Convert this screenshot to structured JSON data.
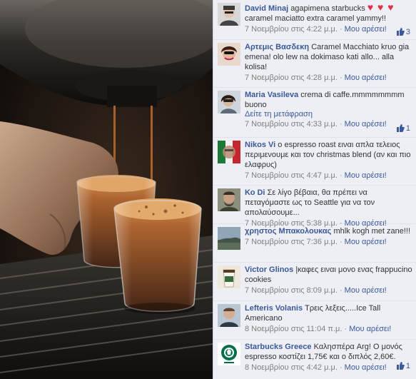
{
  "comments": [
    {
      "author": "David Minaj",
      "text": "agapimena starbucks",
      "hearts": "♥ ♥ ♥",
      "text2": "caramel maciatto extra caramel yammy!!",
      "time": "7 Νοεμβρίου στις 4:22 μ.μ.",
      "like_label": "Μου αρέσει!",
      "likes": "3",
      "sep": " · "
    },
    {
      "author": "Αρτεμις Βασδεκη",
      "text": "Caramel Macchiato kruo gia emena! olo lew na dokimaso kati allo... alla kolisa!",
      "time": "7 Νοεμβρίου στις 4:28 μ.μ.",
      "like_label": "Μου αρέσει!",
      "sep": " · "
    },
    {
      "author": "Maria Vasileva",
      "text": "crema di caffe.mmmmmmmm buono",
      "translate": "Δείτε τη μετάφραση",
      "time": "7 Νοεμβρίου στις 4:33 μ.μ.",
      "like_label": "Μου αρέσει!",
      "likes": "1",
      "sep": " · "
    },
    {
      "author": "Nikos Vi",
      "text": "ο espresso roast ειναι απλα τελειος περιμενουμε και τον christmas blend (αν και πιο ελαφρυς)",
      "time": "7 Νοεμβρίου στις 4:47 μ.μ.",
      "like_label": "Μου αρέσει!",
      "sep": " · "
    },
    {
      "author": "Κο Di",
      "text": "Σε λίγο βέβαια, θα πρέπει να πεταγόμαστε ως το Seattle για να τον απολαύσουμε...",
      "time": "7 Νοεμβρίου στις 5:38 μ.μ.",
      "like_label": "Μου αρέσει!",
      "sep": " · "
    },
    {
      "author": "χρηστος Μπακολουκας",
      "text": "mhlk kogh met zane!!!",
      "time": "7 Νοεμβρίου στις 7:36 μ.μ.",
      "like_label": "Μου αρέσει!",
      "sep": " · "
    },
    {
      "author": "Victor Glinos",
      "text": "|καφες ειναι μονο ενας frappucino cookies",
      "time": "7 Νοεμβρίου στις 8:09 μ.μ.",
      "like_label": "Μου αρέσει!",
      "sep": " · "
    },
    {
      "author": "Lefteris Volanis",
      "text": "Τρεις λεξεις.....Ice Tall Americano",
      "time": "8 Νοεμβρίου στις 11:04 π.μ.",
      "like_label": "Μου αρέσει!",
      "sep": " · "
    },
    {
      "author": "Starbucks Greece",
      "text": "Καλησπέρα Arg! Ο μονός espresso κοστίζει 1,75€ και ο διπλός 2,60€.",
      "time": "8 Νοεμβρίου στις 4:42 μ.μ.",
      "like_label": "Μου αρέσει!",
      "likes": "1",
      "sep": " · "
    }
  ],
  "colors": {
    "link": "#3b5998",
    "panel": "#edeff4",
    "meta": "#808080"
  }
}
